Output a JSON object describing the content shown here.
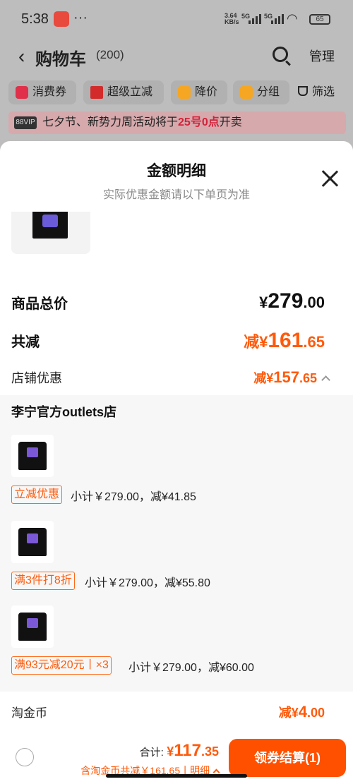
{
  "status_bar": {
    "time": "5:38",
    "more": "···",
    "net_speed_value": "3.64",
    "net_speed_unit": "KB/s",
    "signal_1": "5G",
    "signal_2": "5G",
    "battery": "65"
  },
  "header": {
    "title": "购物车",
    "count": "(200)",
    "manage_label": "管理"
  },
  "filters": [
    {
      "label": "消费券",
      "icon": "coupon-icon",
      "color": "#e0304a"
    },
    {
      "label": "超级立减",
      "icon": "down-arrow-icon",
      "color": "#d32b2b"
    },
    {
      "label": "降价",
      "icon": "price-drop-icon",
      "color": "#f5a623"
    },
    {
      "label": "分组",
      "icon": "folder-icon",
      "color": "#f5a623"
    },
    {
      "label": "筛选",
      "icon": "filter-icon",
      "color": "#222222"
    }
  ],
  "notice": {
    "badge": "88VIP",
    "text_before": "七夕节、新势力周活动将于",
    "highlight": "25号0点",
    "text_after": "开卖"
  },
  "sheet": {
    "title": "金额明细",
    "subtitle": "实际优惠金额请以下单页为准",
    "total_label": "商品总价",
    "total_symbol": "¥",
    "total_int": "279",
    "total_dec": ".00",
    "reduce_label": "共减",
    "reduce_prefix": "减¥",
    "reduce_int": "161",
    "reduce_dec": ".65",
    "store_label": "店铺优惠",
    "store_prefix": "减¥",
    "store_int": "157",
    "store_dec": ".65",
    "store_name": "李宁官方outlets店",
    "items": [
      {
        "tag": "立减优惠",
        "subtotal": "小计￥279.00，减¥41.85"
      },
      {
        "tag": "满3件打8折",
        "subtotal": "小计￥279.00，减¥55.80"
      },
      {
        "tag": "满93元减20元丨×3",
        "subtotal": "小计￥279.00，减¥60.00"
      }
    ],
    "coin_label": "淘金币",
    "coin_prefix": "减¥",
    "coin_int": "4",
    "coin_dec": ".00"
  },
  "checkout": {
    "sum_label": "合计:",
    "sum_symbol": "¥",
    "sum_int": "117",
    "sum_dec": ".35",
    "sub_text": "含淘金币共减￥161.65丨明细",
    "button_label": "领券结算(1)"
  }
}
